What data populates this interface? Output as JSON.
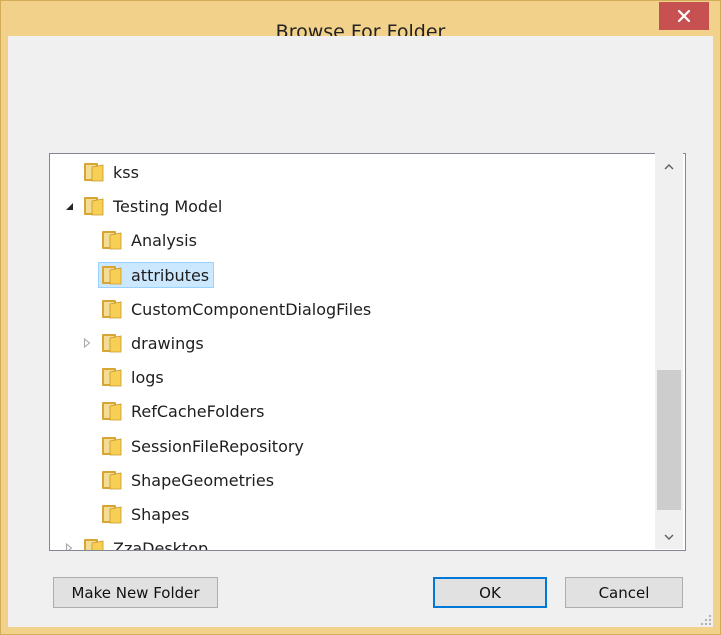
{
  "window": {
    "title": "Browse For Folder",
    "close_glyph": "✕",
    "frame_color": "#f2d18a",
    "close_color": "#c75050"
  },
  "tree": {
    "items": [
      {
        "label": "kss",
        "level": 0,
        "expander": "none",
        "selected": false
      },
      {
        "label": "Testing Model",
        "level": 0,
        "expander": "expanded",
        "selected": false
      },
      {
        "label": "Analysis",
        "level": 1,
        "expander": "none",
        "selected": false
      },
      {
        "label": "attributes",
        "level": 1,
        "expander": "none",
        "selected": true
      },
      {
        "label": "CustomComponentDialogFiles",
        "level": 1,
        "expander": "none",
        "selected": false
      },
      {
        "label": "drawings",
        "level": 1,
        "expander": "collapsed",
        "selected": false
      },
      {
        "label": "logs",
        "level": 1,
        "expander": "none",
        "selected": false
      },
      {
        "label": "RefCacheFolders",
        "level": 1,
        "expander": "none",
        "selected": false
      },
      {
        "label": "SessionFileRepository",
        "level": 1,
        "expander": "none",
        "selected": false
      },
      {
        "label": "ShapeGeometries",
        "level": 1,
        "expander": "none",
        "selected": false
      },
      {
        "label": "Shapes",
        "level": 1,
        "expander": "none",
        "selected": false
      },
      {
        "label": "ZzaDesktop",
        "level": 0,
        "expander": "collapsed",
        "selected": false
      }
    ]
  },
  "buttons": {
    "make_new_folder": "Make New Folder",
    "ok": "OK",
    "cancel": "Cancel"
  },
  "scrollbar": {
    "position_fraction": 0.85
  },
  "icons": {
    "folder": "folder-icon",
    "expand": "triangle-right-icon",
    "collapse": "triangle-down-icon",
    "scroll_up": "chevron-up-icon",
    "scroll_down": "chevron-down-icon",
    "close": "close-icon",
    "resize": "resize-grip-icon"
  }
}
